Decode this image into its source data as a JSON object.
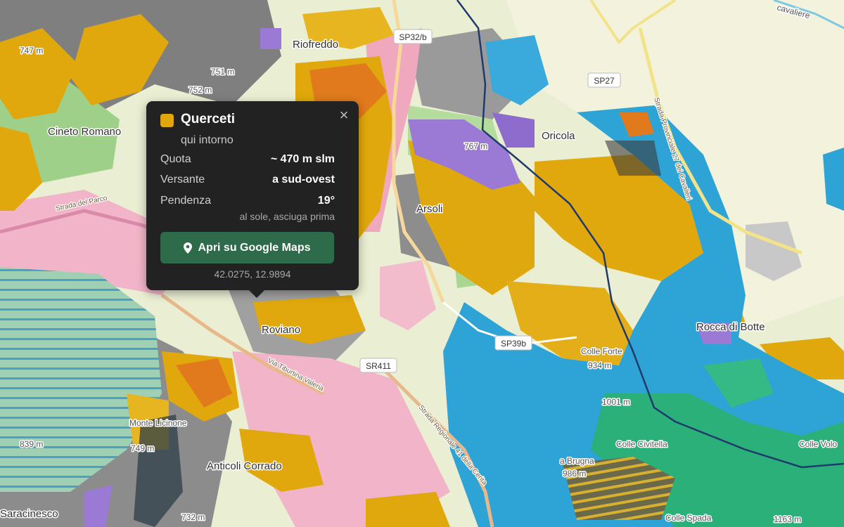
{
  "map": {
    "places": [
      {
        "id": "riofreddo",
        "label": "Riofreddo"
      },
      {
        "id": "cineto",
        "label": "Cineto Romano"
      },
      {
        "id": "oricola",
        "label": "Oricola"
      },
      {
        "id": "arsoli",
        "label": "Arsoli"
      },
      {
        "id": "roviano",
        "label": "Roviano"
      },
      {
        "id": "rocca",
        "label": "Rocca di Botte"
      },
      {
        "id": "colle-forte",
        "label": "Colle Forte"
      },
      {
        "id": "anticoli",
        "label": "Anticoli Corrado"
      },
      {
        "id": "colle-civitella",
        "label": "Colle Civitella"
      },
      {
        "id": "colle-volo",
        "label": "Colle Volo"
      },
      {
        "id": "saracinesco",
        "label": "Saracinesco"
      },
      {
        "id": "colle-spada",
        "label": "Colle Spada"
      },
      {
        "id": "monte-lecinone",
        "label": "Monte Licinone"
      },
      {
        "id": "la-brugna",
        "label": "a Brugna"
      },
      {
        "id": "le-cave",
        "label": "cavaliere"
      }
    ],
    "elevations": [
      {
        "id": "e747",
        "label": "747 m"
      },
      {
        "id": "e751",
        "label": "751 m"
      },
      {
        "id": "e752",
        "label": "752 m"
      },
      {
        "id": "e767",
        "label": "767 m"
      },
      {
        "id": "e934",
        "label": "934 m"
      },
      {
        "id": "e1001",
        "label": "1001 m"
      },
      {
        "id": "e839",
        "label": "839 m"
      },
      {
        "id": "e749",
        "label": "749 m"
      },
      {
        "id": "e732",
        "label": "732 m"
      },
      {
        "id": "e986",
        "label": "986 m"
      },
      {
        "id": "e1163",
        "label": "1163 m"
      }
    ],
    "roads": [
      {
        "id": "sp27",
        "label": "SP27"
      },
      {
        "id": "sp32b",
        "label": "SP32/b"
      },
      {
        "id": "sp39b",
        "label": "SP39b"
      },
      {
        "id": "sr411",
        "label": "SR411"
      },
      {
        "id": "tiburtina",
        "label": "Via Tiburtina Valeria"
      },
      {
        "id": "prov27",
        "label": "Strada Provinciale 27 dei Cavalieri"
      },
      {
        "id": "reg41",
        "label": "Strada Regionale 41 della Cerita"
      },
      {
        "id": "parco",
        "label": "Strada del Parco"
      }
    ]
  },
  "popup": {
    "color": "#e0a80c",
    "title": "Querceti",
    "subtitle": "qui intorno",
    "rows": [
      {
        "key": "Quota",
        "value": "~ 470 m slm"
      },
      {
        "key": "Versante",
        "value": "a sud-ovest"
      },
      {
        "key": "Pendenza",
        "value": "19°"
      }
    ],
    "note": "al sole, asciuga prima",
    "button_label": "Apri su Google Maps",
    "coords": "42.0275, 12.9894",
    "close_glyph": "×"
  },
  "colors": {
    "oak": "#e0a80c",
    "beech": "#2ea3d6",
    "conifer": "#2bb07a",
    "chestnut": "#e07a1d",
    "shrub": "#9b7ad6",
    "urban": "#f2b4c8",
    "grass": "#9fd08a",
    "rock": "#8a8a8a",
    "border": "#1f3b6b"
  }
}
